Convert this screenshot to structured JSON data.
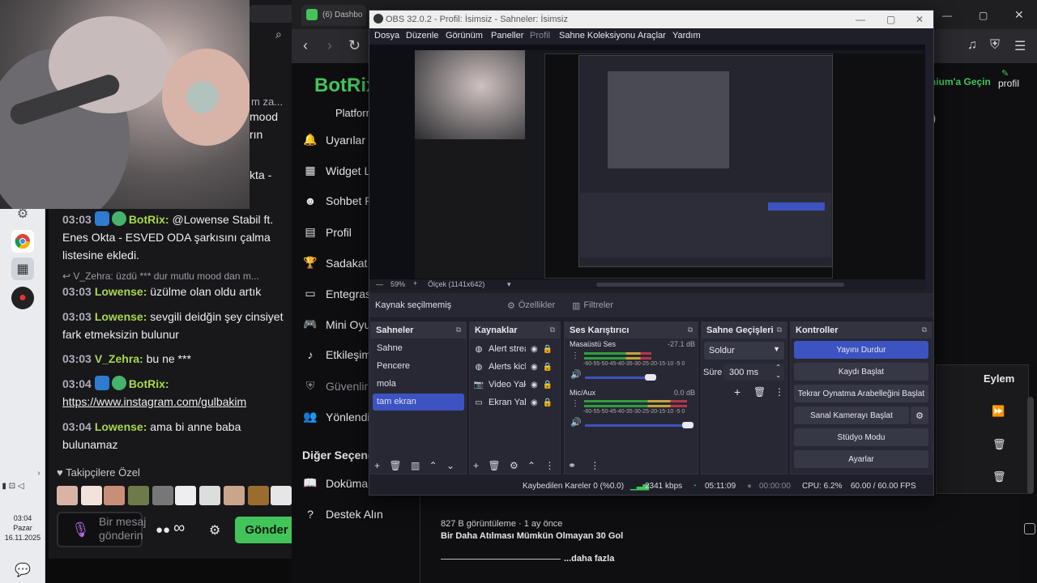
{
  "taskbar": {
    "clock_time": "03:04",
    "clock_day": "Pazar",
    "clock_date": "16.11.2025"
  },
  "chat": {
    "partial_lines": [
      "m za...",
      "mood",
      "rın",
      "kta -"
    ],
    "messages": [
      {
        "time": "03:03",
        "user": "BotRix:",
        "text": "@Lowense Stabil ft. Enes Okta - ESVED ODA şarkısını çalma listesine ekledi."
      },
      {
        "reply": "V_Zehra: üzdü *** dur mutlu mood dan m..."
      },
      {
        "time": "03:03",
        "user": "Lowense:",
        "text": "üzülme olan oldu artık"
      },
      {
        "time": "03:03",
        "user": "Lowense:",
        "text": "sevgili deidğin şey cinsiyet fark etmeksizin bulunur"
      },
      {
        "time": "03:03",
        "user": "V_Zehra:",
        "text": "bu ne ***"
      },
      {
        "time": "03:04",
        "user": "BotRix:",
        "text": "https://www.instagram.com/gulbakim"
      },
      {
        "time": "03:04",
        "user": "Lowense:",
        "text": "ama bi anne baba bulunamaz"
      }
    ],
    "followers_label": "Takipçilere Özel",
    "input_placeholder": "Bir mesaj gönderin",
    "infinity": "∞",
    "send_label": "Gönder"
  },
  "browser": {
    "tab_title": "(6) Dashbo",
    "logo": "BotRix",
    "platform_label": "Platform",
    "sidebar": [
      {
        "label": "Uyarılar",
        "icon": "bell-icon"
      },
      {
        "label": "Widget Li",
        "icon": "grid-icon"
      },
      {
        "label": "Sohbet R",
        "icon": "robot-icon"
      },
      {
        "label": "Profil",
        "icon": "id-card-icon"
      },
      {
        "label": "Sadakat S",
        "icon": "trophy-icon"
      },
      {
        "label": "Entegrasy",
        "icon": "monitor-icon"
      },
      {
        "label": "Mini Oyu",
        "icon": "gamepad-icon"
      },
      {
        "label": "Etkileşiml",
        "icon": "music-icon"
      },
      {
        "label": "Güvenlir",
        "icon": "shield-icon"
      },
      {
        "label": "Yönlendir",
        "icon": "users-icon"
      }
    ],
    "other_settings": "Diğer Seçenel",
    "sidebar_bottom": [
      {
        "label": "Dokümar",
        "icon": "book-icon"
      },
      {
        "label": "Destek Alın",
        "icon": "help-icon"
      }
    ],
    "premium": "nium'a Geçin",
    "profile": "profil",
    "actions_title": "Eylem",
    "yt_views": "827 B görüntüleme · 1 ay önce",
    "yt_title": "Bir Daha Atılması Mümkün Olmayan 30 Gol",
    "yt_more": "...daha fazla"
  },
  "obs": {
    "title": "OBS 32.0.2 - Profil: İsimsiz - Sahneler: İsimsiz",
    "menu": [
      "Dosya",
      "Düzenle",
      "Görünüm",
      "Paneller",
      "Profil",
      "Sahne Koleksiyonu",
      "Araçlar",
      "Yardım"
    ],
    "preview": {
      "zoom": "59%",
      "scale": "Ölçek (1141x642)"
    },
    "source_bar": {
      "none_selected": "Kaynak seçilmemiş",
      "properties": "Özellikler",
      "filters": "Filtreler"
    },
    "scenes": {
      "title": "Sahneler",
      "items": [
        "Sahne",
        "Pencere",
        "mola",
        "tam ekran"
      ],
      "selected_index": 3
    },
    "sources": {
      "title": "Kaynaklar",
      "items": [
        {
          "name": "Alert strea",
          "icon": "globe-icon"
        },
        {
          "name": "Alerts kick",
          "icon": "globe-icon"
        },
        {
          "name": "Video Yak",
          "icon": "camera-icon"
        },
        {
          "name": "Ekran Yak",
          "icon": "display-icon"
        }
      ]
    },
    "mixer": {
      "title": "Ses Karıştırıcı",
      "channels": [
        {
          "name": "Masaüstü Ses",
          "db": "-27.1 dB",
          "level": 0.55
        },
        {
          "name": "Mic/Aux",
          "db": "0.0 dB",
          "level": 1.0
        }
      ],
      "scale": "-60-55-50-45-40-35-30-25-20-15-10 -5 0"
    },
    "transitions": {
      "title": "Sahne Geçişleri",
      "type": "Soldur",
      "duration_label": "Süre",
      "duration": "300 ms"
    },
    "controls": {
      "title": "Kontroller",
      "buttons": [
        "Yayını Durdur",
        "Kaydı Başlat",
        "Tekrar Oynatma Arabelleğini Başlat",
        "Sanal Kamerayı Başlat",
        "Stüdyo Modu",
        "Ayarlar"
      ]
    },
    "status": {
      "dropped": "Kaybedilen Kareler 0 (%0.0)",
      "bitrate": "2341 kbps",
      "stream_time": "05:11:09",
      "rec_time": "00:00:00",
      "cpu": "CPU: 6.2%",
      "fps": "60.00 / 60.00 FPS"
    }
  },
  "colors": {
    "accent_green": "#43c45a",
    "obs_blue": "#3c53c1",
    "obs_bg": "#1e1f29"
  }
}
